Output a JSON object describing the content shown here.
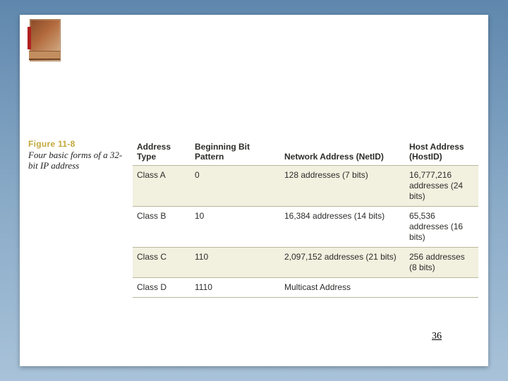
{
  "figure": {
    "label": "Figure 11-8",
    "caption": "Four basic forms of a 32-bit IP address"
  },
  "table": {
    "headers": [
      "Address Type",
      "Beginning Bit Pattern",
      "Network Address (NetID)",
      "Host Address (HostID)"
    ],
    "rows": [
      {
        "type": "Class A",
        "pattern": "0",
        "netid": "128 addresses (7 bits)",
        "hostid": "16,777,216 addresses (24 bits)"
      },
      {
        "type": "Class B",
        "pattern": "10",
        "netid": "16,384 addresses (14 bits)",
        "hostid": "65,536 addresses (16 bits)"
      },
      {
        "type": "Class C",
        "pattern": "110",
        "netid": "2,097,152 addresses (21 bits)",
        "hostid": "256 addresses (8 bits)"
      },
      {
        "type": "Class D",
        "pattern": "1110",
        "netid": "Multicast Address",
        "hostid": ""
      }
    ]
  },
  "page_number": "36"
}
